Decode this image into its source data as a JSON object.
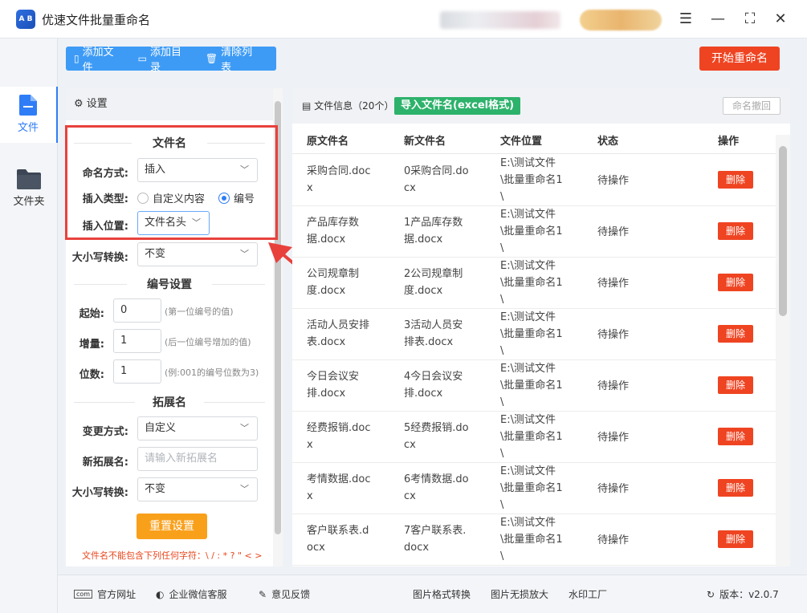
{
  "app": {
    "title": "优速文件批量重命名",
    "logo_text": "A B"
  },
  "nav": [
    {
      "label": "文件",
      "icon": "file-icon"
    },
    {
      "label": "文件夹",
      "icon": "folder-icon"
    }
  ],
  "toolbar": {
    "add_file": "添加文件",
    "add_dir": "添加目录",
    "clear_list": "清除列表",
    "start": "开始重命名"
  },
  "settings": {
    "header": "设置",
    "filename_section": "文件名",
    "naming_mode_label": "命名方式:",
    "naming_mode_value": "插入",
    "insert_type_label": "插入类型:",
    "insert_type_options": [
      "自定义内容",
      "编号"
    ],
    "insert_type_selected": "编号",
    "insert_pos_label": "插入位置:",
    "insert_pos_value": "文件名头",
    "case_label": "大小写转换:",
    "case_value": "不变",
    "number_section": "编号设置",
    "start_label": "起始:",
    "start_value": "0",
    "start_hint": "(第一位编号的值)",
    "step_label": "增量:",
    "step_value": "1",
    "step_hint": "(后一位编号增加的值)",
    "digits_label": "位数:",
    "digits_value": "1",
    "digits_hint": "(例:001的编号位数为3)",
    "ext_section": "拓展名",
    "ext_mode_label": "变更方式:",
    "ext_mode_value": "自定义",
    "new_ext_label": "新拓展名:",
    "new_ext_placeholder": "请输入新拓展名",
    "ext_case_label": "大小写转换:",
    "ext_case_value": "不变",
    "reset": "重置设置",
    "warning": "文件名不能包含下列任何字符：\\ / : * ? \" < >"
  },
  "files": {
    "info": "文件信息（20个）",
    "import_btn": "导入文件名(excel格式)",
    "undo_btn": "命名撤回",
    "columns": [
      "原文件名",
      "新文件名",
      "文件位置",
      "状态",
      "操作"
    ],
    "rows": [
      {
        "orig": [
          "采购合同.doc",
          "x"
        ],
        "new": [
          "0采购合同.do",
          "cx"
        ],
        "path": [
          "E:\\测试文件",
          "\\批量重命名1",
          "\\"
        ],
        "status": "待操作",
        "action": "删除"
      },
      {
        "orig": [
          "产品库存数",
          "据.docx"
        ],
        "new": [
          "1产品库存数",
          "据.docx"
        ],
        "path": [
          "E:\\测试文件",
          "\\批量重命名1",
          "\\"
        ],
        "status": "待操作",
        "action": "删除"
      },
      {
        "orig": [
          "公司规章制",
          "度.docx"
        ],
        "new": [
          "2公司规章制",
          "度.docx"
        ],
        "path": [
          "E:\\测试文件",
          "\\批量重命名1",
          "\\"
        ],
        "status": "待操作",
        "action": "删除"
      },
      {
        "orig": [
          "活动人员安排",
          "表.docx"
        ],
        "new": [
          "3活动人员安",
          "排表.docx"
        ],
        "path": [
          "E:\\测试文件",
          "\\批量重命名1",
          "\\"
        ],
        "status": "待操作",
        "action": "删除"
      },
      {
        "orig": [
          "今日会议安",
          "排.docx"
        ],
        "new": [
          "4今日会议安",
          "排.docx"
        ],
        "path": [
          "E:\\测试文件",
          "\\批量重命名1",
          "\\"
        ],
        "status": "待操作",
        "action": "删除"
      },
      {
        "orig": [
          "经费报销.doc",
          "x"
        ],
        "new": [
          "5经费报销.do",
          "cx"
        ],
        "path": [
          "E:\\测试文件",
          "\\批量重命名1",
          "\\"
        ],
        "status": "待操作",
        "action": "删除"
      },
      {
        "orig": [
          "考情数据.doc",
          "x"
        ],
        "new": [
          "6考情数据.do",
          "cx"
        ],
        "path": [
          "E:\\测试文件",
          "\\批量重命名1",
          "\\"
        ],
        "status": "待操作",
        "action": "删除"
      },
      {
        "orig": [
          "客户联系表.d",
          "ocx"
        ],
        "new": [
          "7客户联系表.",
          "docx"
        ],
        "path": [
          "E:\\测试文件",
          "\\批量重命名1",
          "\\"
        ],
        "status": "待操作",
        "action": "删除"
      }
    ]
  },
  "footer": {
    "website": "官方网址",
    "wechat": "企业微信客服",
    "feedback": "意见反馈",
    "img_convert": "图片格式转换",
    "img_enlarge": "图片无损放大",
    "watermark": "水印工厂",
    "version": "版本：v2.0.7",
    "website_icon_text": "com"
  },
  "colors": {
    "accent": "#2f7df6",
    "danger": "#ef4422",
    "toolbar": "#3d9bf5",
    "import": "#2db26b",
    "reset": "#f9a01b"
  }
}
